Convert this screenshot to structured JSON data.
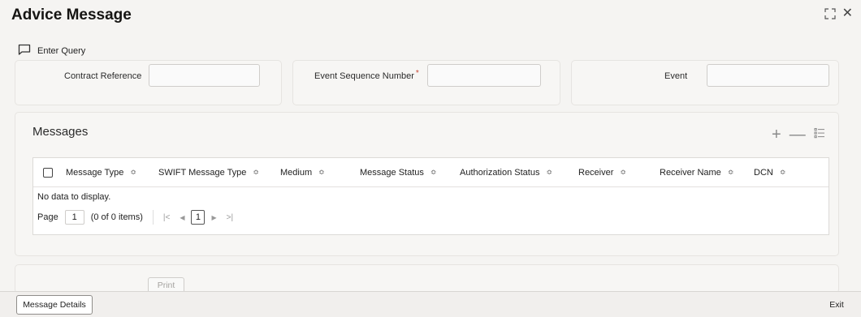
{
  "window": {
    "title": "Advice Message"
  },
  "toolbar": {
    "enter_query_label": "Enter Query"
  },
  "header_fields": {
    "contract_reference_label": "Contract Reference",
    "contract_reference_value": "",
    "event_seq_label": "Event Sequence Number",
    "event_seq_required": "*",
    "event_seq_value": "",
    "event_label": "Event",
    "event_value": ""
  },
  "messages": {
    "title": "Messages",
    "columns": [
      "Message Type",
      "SWIFT Message Type",
      "Medium",
      "Message Status",
      "Authorization Status",
      "Receiver",
      "Receiver Name",
      "DCN"
    ],
    "empty_text": "No data to display.",
    "pager": {
      "page_label": "Page",
      "page_value": "1",
      "items_text": "(0 of 0 items)",
      "current_page": "1"
    }
  },
  "actions": {
    "print_label": "Print"
  },
  "footer": {
    "message_details_label": "Message Details",
    "exit_label": "Exit"
  }
}
